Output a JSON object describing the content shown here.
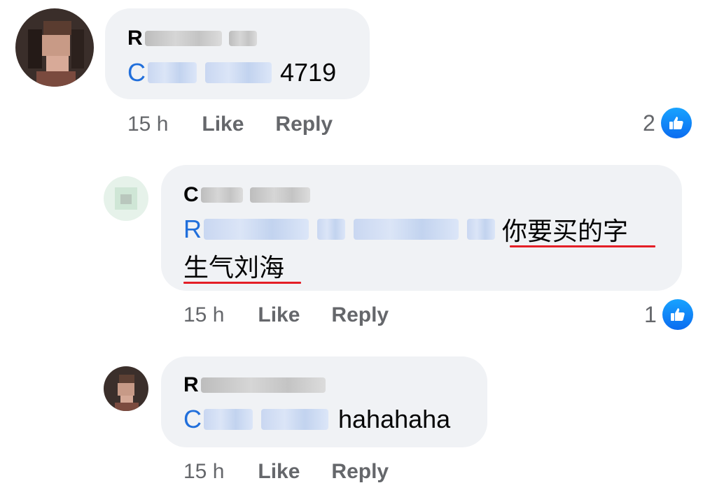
{
  "colors": {
    "bubble": "#f0f2f5",
    "mention": "#216fdb",
    "meta_text": "#65676b",
    "underline": "#e41e26",
    "like_badge": "#1877f2"
  },
  "comments": [
    {
      "author_initial": "R",
      "mention_initial": "C",
      "text": "4719",
      "time": "15 h",
      "like_label": "Like",
      "reply_label": "Reply",
      "reaction_count": "2",
      "reaction_icon": "thumbs-up-icon"
    },
    {
      "author_initial": "C",
      "mention_initial": "R",
      "text_line1": "你要买的字",
      "text_line2": "生气刘海",
      "time": "15 h",
      "like_label": "Like",
      "reply_label": "Reply",
      "reaction_count": "1",
      "reaction_icon": "thumbs-up-icon"
    },
    {
      "author_initial": "R",
      "mention_initial": "C",
      "text": "hahahaha",
      "time": "15 h",
      "like_label": "Like",
      "reply_label": "Reply"
    }
  ]
}
